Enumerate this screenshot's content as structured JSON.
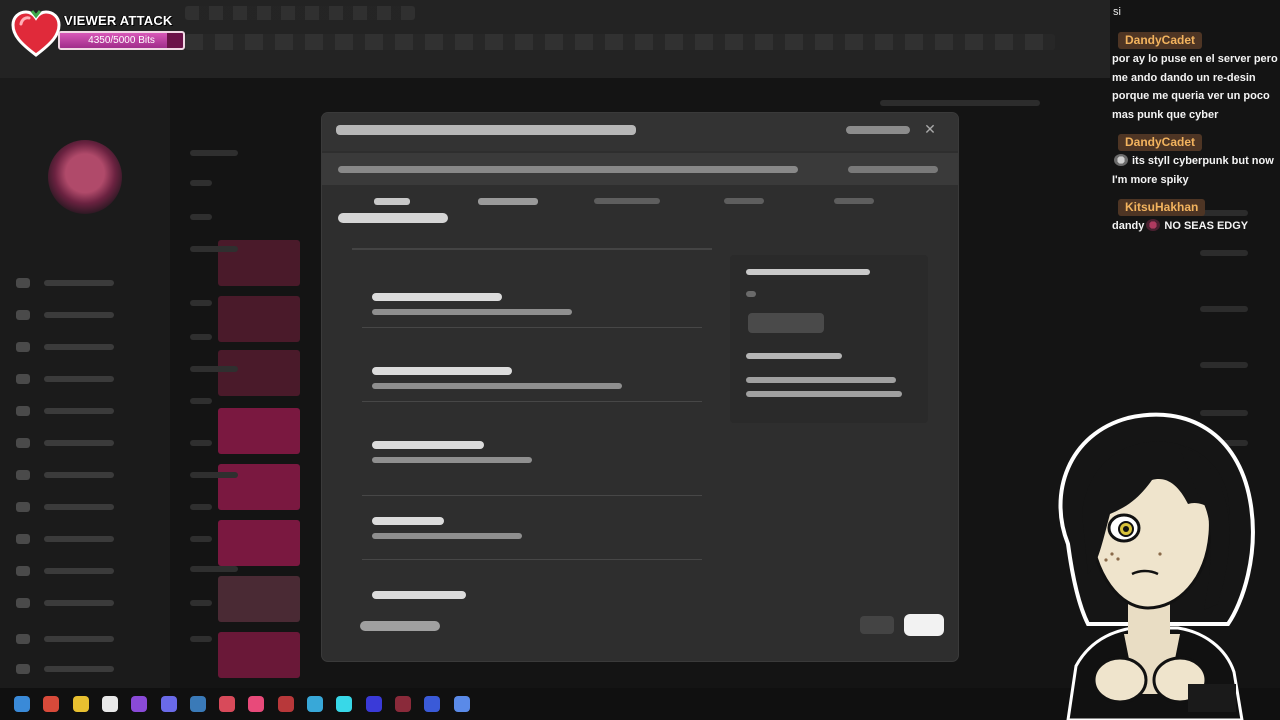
{
  "viewer_attack": {
    "title": "VIEWER ATTACK",
    "bits_label": "4350/5000 Bits",
    "progress_fraction": 0.87,
    "colors": {
      "heart": "#e02a3a",
      "bar": "#b83a9a"
    }
  },
  "chat": {
    "top_message": "si",
    "messages": [
      {
        "user": "DandyCadet",
        "text": "por ay lo puse en el server pero me ando dando un re-desin porque me queria ver un poco mas punk que cyber"
      },
      {
        "user": "DandyCadet",
        "emote": "skull-emote",
        "text": "its styll cyberpunk but now I'm more spiky"
      },
      {
        "user": "KitsuHakhan",
        "text_before": "dandy",
        "emote": "cat-emote",
        "text_after": "NO SEAS EDGY"
      }
    ],
    "colors": {
      "username": "#f2b35e",
      "username_bg": "#4e3524"
    }
  },
  "dialog": {
    "close_icon": "close-icon",
    "state": "obscured"
  },
  "taskbar": {
    "icons": [
      "app-icon-1",
      "app-icon-2",
      "app-icon-3",
      "app-icon-4",
      "app-icon-5",
      "app-icon-6",
      "app-icon-7",
      "app-icon-8",
      "app-icon-9",
      "app-icon-10",
      "app-icon-11",
      "app-icon-12",
      "app-icon-13",
      "app-icon-14",
      "app-icon-15",
      "app-icon-16"
    ]
  }
}
